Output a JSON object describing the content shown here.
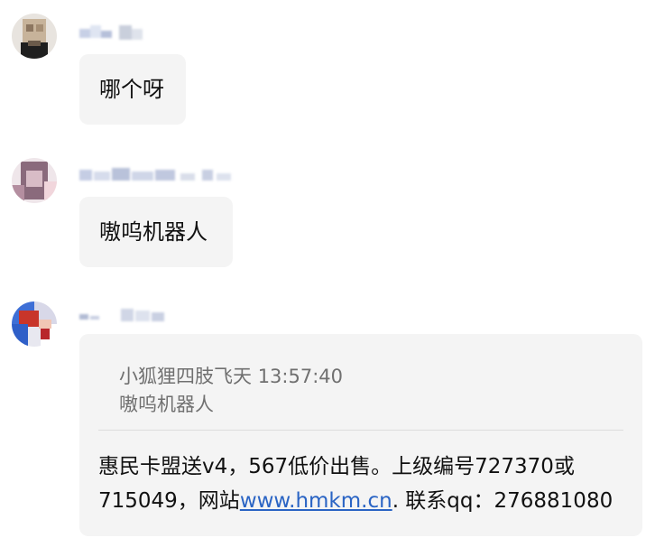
{
  "messages": [
    {
      "text": "哪个呀"
    },
    {
      "text": "嗷呜机器人"
    },
    {
      "quote": {
        "sender": "小狐狸四肢飞天",
        "time": "13:57:40",
        "text": "嗷呜机器人"
      },
      "reply": {
        "line1": "惠民卡盟送v4，567低价出售。上级编号727370或",
        "line2_before": "715049，网站",
        "link": "www.hmkm.cn",
        "line2_after": ". 联系qq：276881080"
      }
    }
  ],
  "colors": {
    "bubble": "#f4f4f4",
    "text": "#111111",
    "muted": "#707070",
    "link": "#2a64c4"
  }
}
